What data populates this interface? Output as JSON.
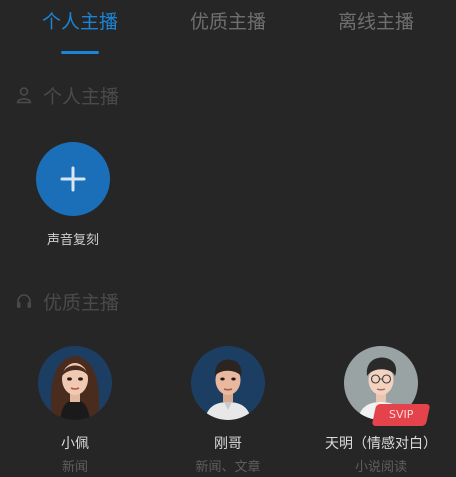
{
  "tabs": [
    {
      "label": "个人主播",
      "active": true
    },
    {
      "label": "优质主播",
      "active": false
    },
    {
      "label": "离线主播",
      "active": false
    }
  ],
  "sections": {
    "personal": {
      "title": "个人主播",
      "icon": "user-icon"
    },
    "quality": {
      "title": "优质主播",
      "icon": "headphones-icon"
    }
  },
  "add_voice": {
    "label": "声音复刻",
    "icon": "plus-icon"
  },
  "anchors": [
    {
      "name": "小佩",
      "tags": "新闻"
    },
    {
      "name": "刚哥",
      "tags": "新闻、文章"
    },
    {
      "name": "天明（情感对白）",
      "tags": "小说阅读",
      "badge": "SVIP"
    }
  ],
  "colors": {
    "accent": "#1a84d6",
    "background": "#262626",
    "badge": "#e5434b"
  }
}
